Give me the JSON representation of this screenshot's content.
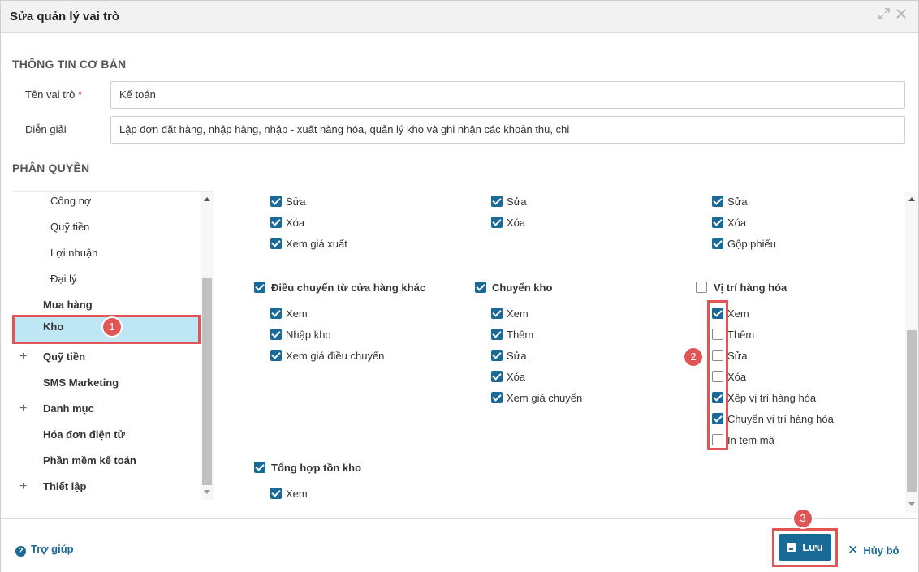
{
  "dialog": {
    "title": "Sửa quản lý vai trò",
    "expand_icon": "expand-icon",
    "close_icon": "close-icon"
  },
  "basic_info": {
    "section_title": "THÔNG TIN CƠ BẢN",
    "role_name_label": "Tên vai trò",
    "required_mark": "*",
    "role_name_value": "Kế toán",
    "description_label": "Diễn giải",
    "description_value": "Lập đơn đặt hàng, nhập hàng, nhập - xuất hàng hóa, quản lý kho và ghi nhận các khoản thu, chi"
  },
  "permissions": {
    "section_title": "PHÂN QUYỀN",
    "tree": [
      {
        "label": "Công nợ",
        "level": "child"
      },
      {
        "label": "Quỹ tiền",
        "level": "child"
      },
      {
        "label": "Lợi nhuận",
        "level": "child"
      },
      {
        "label": "Đại lý",
        "level": "child"
      },
      {
        "label": "Mua hàng",
        "level": "parent"
      },
      {
        "label": "Kho",
        "level": "parent",
        "selected": true
      },
      {
        "label": "Quỹ tiền",
        "level": "parent",
        "expand": "+"
      },
      {
        "label": "SMS Marketing",
        "level": "parent"
      },
      {
        "label": "Danh mục",
        "level": "parent",
        "expand": "+"
      },
      {
        "label": "Hóa đơn điện tử",
        "level": "parent"
      },
      {
        "label": "Phần mềm kế toán",
        "level": "parent"
      },
      {
        "label": "Thiết lập",
        "level": "parent",
        "expand": "+"
      }
    ],
    "col1_top": [
      {
        "label": "Sửa",
        "checked": true
      },
      {
        "label": "Xóa",
        "checked": true
      },
      {
        "label": "Xem giá xuất",
        "checked": true
      }
    ],
    "col2_top": [
      {
        "label": "Sửa",
        "checked": true
      },
      {
        "label": "Xóa",
        "checked": true
      }
    ],
    "col3_top": [
      {
        "label": "Sửa",
        "checked": true
      },
      {
        "label": "Xóa",
        "checked": true
      },
      {
        "label": "Gộp phiếu",
        "checked": true
      }
    ],
    "group_transfer_other": {
      "label": "Điều chuyển từ cửa hàng khác",
      "checked": true,
      "items": [
        {
          "label": "Xem",
          "checked": true
        },
        {
          "label": "Nhập kho",
          "checked": true
        },
        {
          "label": "Xem giá điều chuyển",
          "checked": true
        }
      ]
    },
    "group_transfer": {
      "label": "Chuyển kho",
      "checked": true,
      "items": [
        {
          "label": "Xem",
          "checked": true
        },
        {
          "label": "Thêm",
          "checked": true
        },
        {
          "label": "Sửa",
          "checked": true
        },
        {
          "label": "Xóa",
          "checked": true
        },
        {
          "label": "Xem giá chuyển",
          "checked": true
        }
      ]
    },
    "group_location": {
      "label": "Vị trí hàng hóa",
      "checked": false,
      "items": [
        {
          "label": "Xem",
          "checked": true
        },
        {
          "label": "Thêm",
          "checked": false
        },
        {
          "label": "Sửa",
          "checked": false
        },
        {
          "label": "Xóa",
          "checked": false
        },
        {
          "label": "Xếp vị trí hàng hóa",
          "checked": true
        },
        {
          "label": "Chuyển vị trí hàng hóa",
          "checked": true
        },
        {
          "label": "In tem mã",
          "checked": false
        }
      ]
    },
    "group_inventory": {
      "label": "Tổng hợp tồn kho",
      "checked": true,
      "items": [
        {
          "label": "Xem",
          "checked": true
        }
      ]
    }
  },
  "steps": [
    "1",
    "2",
    "3"
  ],
  "footer": {
    "help_label": "Trợ giúp",
    "help_icon": "question-circle-icon",
    "save_label": "Lưu",
    "save_icon": "floppy-disk-icon",
    "cancel_label": "Hủy bỏ",
    "cancel_icon": "x-icon"
  },
  "colors": {
    "accent": "#1a6a97",
    "selected_row": "#bfe6f5",
    "annotation_red": "#e05555"
  }
}
